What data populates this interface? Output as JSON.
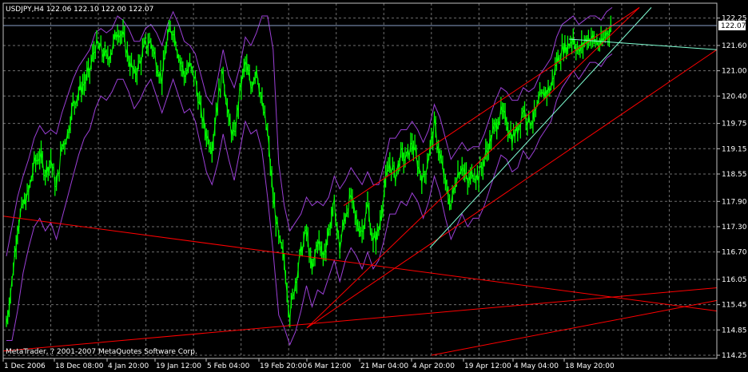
{
  "header": {
    "title": "USDJPY,H4  122.06 122.10 122.00 122.07"
  },
  "copyright": "MetaTrader, ? 2001-2007 MetaQuotes Software Corp.",
  "colors": {
    "background": "#000000",
    "price": "#00ff00",
    "envelope": "#9b3fd6",
    "grid": "#6e6e6e",
    "channel": "#ff0000",
    "trend": "#7fffd4",
    "bid_line": "#8aa0c8"
  },
  "chart_data": {
    "type": "line",
    "title": "USDJPY,H4",
    "ohlc": {
      "open": 122.06,
      "high": 122.1,
      "low": 122.0,
      "close": 122.07
    },
    "ylim": [
      114.25,
      122.3
    ],
    "y_ticks": [
      "122.25",
      "121.60",
      "121.00",
      "120.40",
      "119.75",
      "119.15",
      "118.55",
      "117.90",
      "117.30",
      "116.70",
      "116.05",
      "115.45",
      "114.85",
      "114.25"
    ],
    "current_price": "122.07",
    "x_ticks": [
      "1 Dec 2006",
      "18 Dec 08:00",
      "4 Jan 20:00",
      "19 Jan 12:00",
      "5 Feb 04:00",
      "19 Feb 20:00",
      "6 Mar 12:00",
      "21 Mar 04:00",
      "4 Apr 20:00",
      "19 Apr 12:00",
      "4 May 04:00",
      "18 May 20:00"
    ],
    "grid": true,
    "series": [
      {
        "values": [
          115.0,
          116.0,
          117.3,
          117.8,
          118.1,
          118.8,
          119.0,
          118.6,
          118.9,
          118.2,
          119.2,
          119.5,
          120.2,
          120.5,
          120.7,
          121.0,
          121.6,
          121.5,
          121.3,
          121.5,
          122.0,
          121.8,
          121.3,
          120.9,
          121.2,
          121.6,
          121.7,
          121.2,
          120.8,
          121.8,
          122.0,
          121.4,
          120.9,
          121.1,
          120.8,
          120.0,
          119.5,
          119.2,
          120.3,
          121.0,
          119.8,
          119.4,
          120.5,
          121.2,
          120.6,
          121.1,
          120.2,
          119.5,
          118.0,
          117.0,
          116.5,
          115.2,
          116.0,
          116.7,
          117.2,
          116.2,
          117.0,
          116.6,
          117.2,
          117.8,
          116.8,
          117.6,
          118.0,
          117.4,
          117.2,
          117.8,
          116.9,
          117.2,
          118.2,
          118.8,
          118.5,
          119.0,
          118.9,
          119.3,
          118.8,
          118.4,
          119.0,
          119.7,
          119.0,
          118.3,
          117.8,
          118.5,
          118.8,
          118.3,
          118.6,
          118.5,
          118.9,
          119.3,
          119.7,
          120.0,
          119.8,
          119.4,
          119.6,
          120.1,
          119.8,
          119.9,
          120.3,
          120.5,
          120.6,
          121.2,
          121.5,
          121.6,
          121.8,
          121.4,
          121.7,
          121.8,
          121.7,
          121.6,
          121.9,
          122.07
        ]
      }
    ],
    "upper_envelope": [
      116.6,
      117.3,
      118.0,
      118.5,
      118.9,
      119.4,
      119.7,
      119.5,
      119.6,
      119.5,
      120.0,
      120.4,
      120.8,
      121.1,
      121.3,
      121.5,
      121.9,
      122.0,
      121.9,
      122.0,
      122.3,
      122.2,
      122.0,
      121.7,
      121.7,
      122.0,
      122.1,
      121.9,
      121.6,
      122.1,
      122.4,
      122.1,
      121.7,
      121.6,
      121.4,
      120.9,
      120.4,
      120.2,
      120.8,
      121.5,
      120.9,
      120.6,
      121.1,
      121.8,
      121.6,
      121.9,
      122.3,
      122.3,
      121.5,
      118.8,
      117.8,
      117.2,
      117.4,
      117.6,
      118.0,
      117.8,
      117.9,
      117.8,
      118.0,
      118.5,
      118.2,
      118.4,
      118.7,
      118.5,
      118.3,
      118.6,
      118.3,
      118.3,
      118.8,
      119.4,
      119.4,
      119.6,
      119.6,
      119.8,
      119.6,
      119.3,
      119.6,
      120.2,
      119.9,
      119.4,
      118.9,
      119.1,
      119.3,
      119.1,
      119.2,
      119.2,
      119.5,
      119.9,
      120.3,
      120.6,
      120.5,
      120.3,
      120.3,
      120.6,
      120.5,
      120.6,
      120.9,
      121.1,
      121.3,
      121.8,
      122.1,
      122.2,
      122.3,
      122.1,
      122.2,
      122.3,
      122.3,
      122.2,
      122.4,
      122.5
    ],
    "lower_envelope": [
      114.6,
      114.6,
      115.3,
      116.2,
      116.8,
      117.3,
      117.5,
      117.2,
      117.4,
      117.0,
      117.5,
      118.0,
      118.5,
      119.0,
      119.4,
      119.6,
      120.1,
      120.4,
      120.3,
      120.5,
      120.8,
      120.8,
      120.5,
      120.1,
      120.3,
      120.6,
      120.8,
      120.4,
      120.0,
      120.4,
      120.8,
      120.4,
      120.0,
      120.1,
      119.8,
      119.2,
      118.6,
      118.3,
      118.8,
      119.5,
      118.9,
      118.4,
      119.1,
      119.8,
      119.5,
      119.6,
      119.1,
      118.0,
      116.7,
      115.2,
      114.9,
      114.5,
      114.8,
      115.3,
      115.9,
      115.4,
      115.8,
      115.7,
      116.1,
      116.5,
      116.0,
      116.5,
      116.8,
      116.6,
      116.3,
      116.7,
      116.3,
      116.5,
      117.0,
      117.6,
      117.6,
      117.9,
      117.8,
      118.1,
      117.9,
      117.5,
      117.9,
      118.5,
      118.1,
      117.5,
      117.0,
      117.3,
      117.6,
      117.3,
      117.5,
      117.5,
      117.8,
      118.2,
      118.6,
      119.0,
      118.9,
      118.6,
      118.7,
      119.1,
      118.9,
      119.1,
      119.4,
      119.6,
      119.8,
      120.3,
      120.6,
      120.8,
      121.0,
      120.8,
      121.0,
      121.2,
      121.2,
      121.1,
      121.3,
      121.4
    ]
  }
}
